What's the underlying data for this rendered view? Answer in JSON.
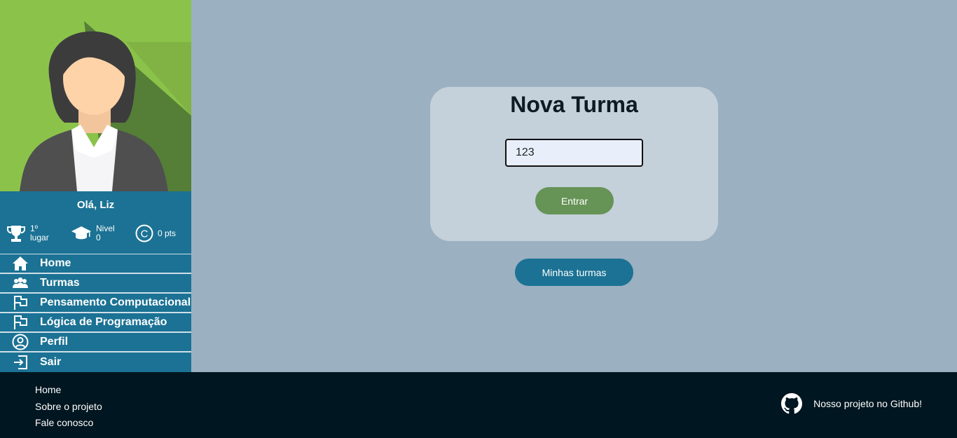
{
  "sidebar": {
    "greeting": "Olá, Liz",
    "stats": {
      "rank_value": "1º",
      "rank_label": "lugar",
      "level_label": "Nivel",
      "level_value": "0",
      "points": "0 pts"
    },
    "menu": [
      {
        "label": "Home",
        "icon": "home-icon"
      },
      {
        "label": "Turmas",
        "icon": "users-icon"
      },
      {
        "label": "Pensamento Computacional",
        "icon": "flag-icon"
      },
      {
        "label": "Lógica de Programação",
        "icon": "flag-icon"
      },
      {
        "label": "Perfil",
        "icon": "user-circle-icon"
      },
      {
        "label": "Sair",
        "icon": "logout-icon"
      }
    ]
  },
  "card": {
    "title": "Nova Turma",
    "code_value": "123",
    "enter_label": "Entrar"
  },
  "my_classes_label": "Minhas turmas",
  "footer": {
    "links": [
      "Home",
      "Sobre o projeto",
      "Fale conosco"
    ],
    "github_label": "Nosso projeto no Github!"
  },
  "colors": {
    "background": "#9bb0c0",
    "sidebar": "#1b7294",
    "card": "#c4d0da",
    "enter_button": "#669356",
    "footer": "#001620"
  }
}
